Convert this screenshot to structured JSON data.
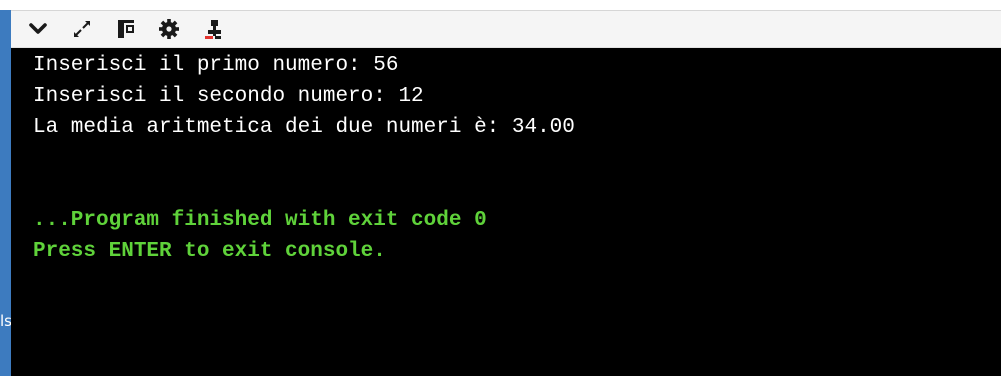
{
  "toolbar": {
    "tools": [
      {
        "icon": "chevron-down-icon"
      },
      {
        "icon": "expand-icon"
      },
      {
        "icon": "layout-icon"
      },
      {
        "icon": "gear-icon"
      },
      {
        "icon": "share-icon"
      }
    ]
  },
  "sidebar": {
    "label": "ls"
  },
  "console": {
    "output_lines": [
      "Inserisci il primo numero: 56",
      "Inserisci il secondo numero: 12",
      "La media aritmetica dei due numeri è: 34.00"
    ],
    "status_lines": [
      "...Program finished with exit code 0",
      "Press ENTER to exit console."
    ]
  },
  "colors": {
    "console_background": "#000000",
    "output_text": "#ffffff",
    "status_text": "#5fd23a",
    "sidebar_accent": "#3d7bbf",
    "toolbar_background": "#f5f5f5"
  }
}
